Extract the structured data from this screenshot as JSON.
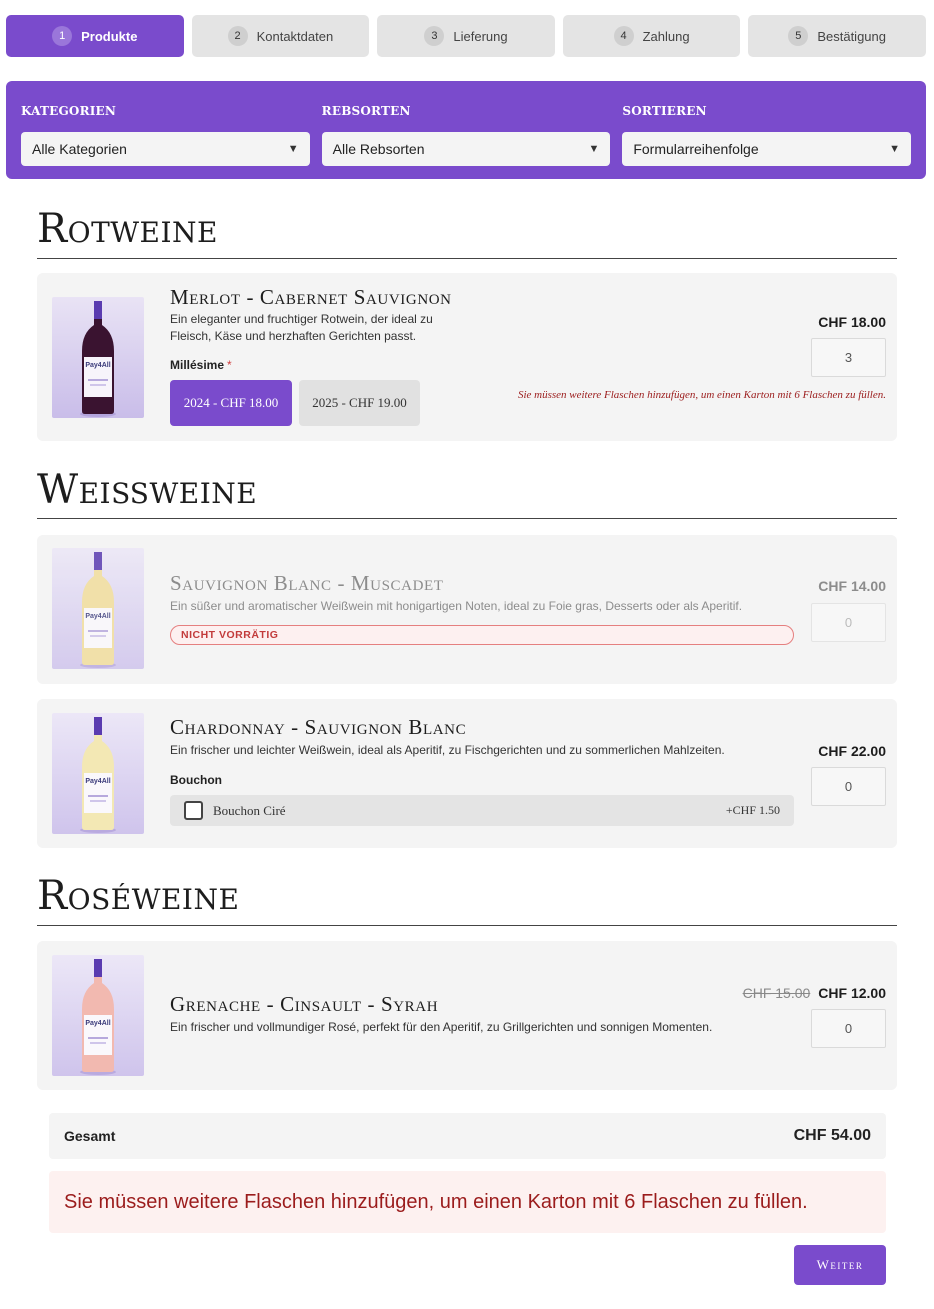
{
  "steps": [
    {
      "num": "1",
      "label": "Produkte"
    },
    {
      "num": "2",
      "label": "Kontaktdaten"
    },
    {
      "num": "3",
      "label": "Lieferung"
    },
    {
      "num": "4",
      "label": "Zahlung"
    },
    {
      "num": "5",
      "label": "Bestätigung"
    }
  ],
  "filters": {
    "category": {
      "label": "KATEGORIEN",
      "value": "Alle Kategorien"
    },
    "grape": {
      "label": "REBSORTEN",
      "value": "Alle Rebsorten"
    },
    "sort": {
      "label": "SORTIEREN",
      "value": "Formularreihenfolge"
    },
    "arrow_glyph": "▼"
  },
  "sections": {
    "red": {
      "title": "Rotweine"
    },
    "white": {
      "title": "Weißweine"
    },
    "rose": {
      "title": "Roséweine"
    }
  },
  "products": {
    "merlot": {
      "name": "Merlot - Cabernet Sauvignon",
      "desc_line1": "Ein eleganter und fruchtiger Rotwein, der ideal zu",
      "desc_line2": "Fleisch, Käse und herzhaften Gerichten passt.",
      "price": "CHF 18.00",
      "qty": "3",
      "option_label": "Millésime",
      "required_mark": "*",
      "variants": [
        "2024  -  CHF 18.00",
        "2025  -  CHF 19.00"
      ],
      "selected_variant": "2024",
      "warning": "Sie müssen weitere Flaschen hinzufügen, um einen Karton mit 6 Flaschen zu füllen.",
      "wine_color": "#3a1330"
    },
    "sauvignon": {
      "name": "Sauvignon Blanc - Muscadet",
      "desc": "Ein süßer und aromatischer Weißwein mit honigartigen Noten, ideal zu Foie gras, Desserts oder als Aperitif.",
      "price": "CHF 14.00",
      "qty": "0",
      "badge": "NICHT VORRÄTIG",
      "in_stock": false,
      "wine_color": "#f1dd9c"
    },
    "chardonnay": {
      "name": "Chardonnay - Sauvignon Blanc",
      "desc": "Ein frischer und leichter Weißwein, ideal als Aperitif, zu Fischgerichten und zu sommerlichen Mahlzeiten.",
      "price": "CHF 22.00",
      "qty": "0",
      "option_label": "Bouchon",
      "addon_name": "Bouchon Ciré",
      "addon_price": "+CHF 1.50",
      "addon_checked": false,
      "wine_color": "#f3e8b4"
    },
    "grenache": {
      "name": "Grenache - Cinsault - Syrah",
      "desc": "Ein frischer und vollmundiger Rosé, perfekt für den Aperitif, zu Grillgerichten und sonnigen Momenten.",
      "old_price": "CHF 15.00",
      "price": "CHF 12.00",
      "qty": "0",
      "wine_color": "#f2b9b0"
    }
  },
  "bottle_label_text": "Pay4All",
  "total": {
    "label": "Gesamt",
    "value": "CHF 54.00"
  },
  "alert": "Sie müssen weitere Flaschen hinzufügen, um einen Karton mit 6 Flaschen zu füllen.",
  "next_button": "Weiter",
  "colors": {
    "accent": "#7a4bcc",
    "card_bg": "#f4f4f4",
    "warning": "#9b1c1c",
    "badge_red": "#c23b3b"
  }
}
